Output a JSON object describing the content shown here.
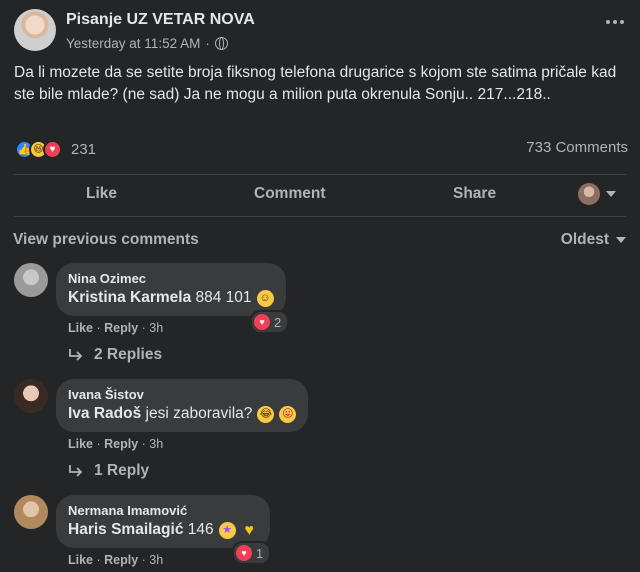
{
  "post": {
    "author": "Pisanje UZ VETAR NOVA",
    "timestamp": "Yesterday at 11:52 AM",
    "dot": "·",
    "text": "Da li mozete da se setite broja fiksnog telefona drugarice s kojom ste satima pričale kad ste bile mlade? (ne sad) Ja ne mogu a milion puta okrenula Sonju.. 217...218..",
    "reaction_count": "231",
    "comment_count": "733 Comments",
    "reaction_icons": [
      "like-icon",
      "haha-icon",
      "love-icon"
    ]
  },
  "actions": {
    "like": "Like",
    "comment": "Comment",
    "share": "Share"
  },
  "comments_header": {
    "view_previous": "View previous comments",
    "sort": "Oldest"
  },
  "comments": [
    {
      "name": "Nina Ozimec",
      "mention": "Kristina Karmela",
      "text": " 884 101",
      "emoji": [
        "smile-emoji"
      ],
      "reaction_count": "2",
      "like": "Like",
      "reply": "Reply",
      "time": "3h",
      "replies": "2 Replies"
    },
    {
      "name": "Ivana Šistov",
      "mention": "Iva Radoš",
      "text": " jesi zaboravila?",
      "emoji": [
        "joy-emoji",
        "tongue-emoji"
      ],
      "like": "Like",
      "reply": "Reply",
      "time": "3h",
      "replies": "1 Reply"
    },
    {
      "name": "Nermana Imamović",
      "mention": "Haris Smailagić",
      "text": " 146",
      "emoji": [
        "star-eyes-emoji",
        "yellow-heart-emoji"
      ],
      "reaction_count": "1",
      "like": "Like",
      "reply": "Reply",
      "time": "3h"
    }
  ],
  "colors": {
    "background": "#242526",
    "bubble": "#3a3b3c",
    "primary_text": "#e4e6eb",
    "secondary_text": "#b0b3b8",
    "like_blue": "#2d88ff",
    "love_red": "#f33e58"
  }
}
